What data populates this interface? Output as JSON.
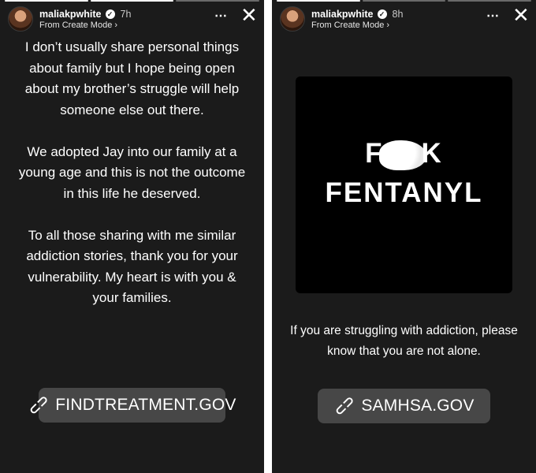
{
  "stories": [
    {
      "username": "maliakpwhite",
      "time": "7h",
      "subtitle": "From Create Mode ›",
      "more": "⋯",
      "close": "✕",
      "paragraphs": [
        "I don’t usually share personal things about family but I hope being open about my brother’s struggle will help someone else out there.",
        "We  adopted Jay into our family at a young age and this is not the outcome in this life he deserved.",
        "To all those sharing with me similar addiction stories, thank you for your vulnerability. My heart is with you & your families."
      ],
      "link": "FINDTREATMENT.GOV"
    },
    {
      "username": "maliakpwhite",
      "time": "8h",
      "subtitle": "From Create Mode ›",
      "more": "⋯",
      "close": "✕",
      "graphic": {
        "line1_start": "F",
        "line1_end": "K",
        "line2": "FENTANYL"
      },
      "caption": "If you are struggling with addiction, please know that you are not alone.",
      "link": "SAMHSA.GOV"
    }
  ],
  "icons": {
    "verified": "verified-badge-icon",
    "link": "link-icon",
    "more": "more-icon",
    "close": "close-icon"
  }
}
